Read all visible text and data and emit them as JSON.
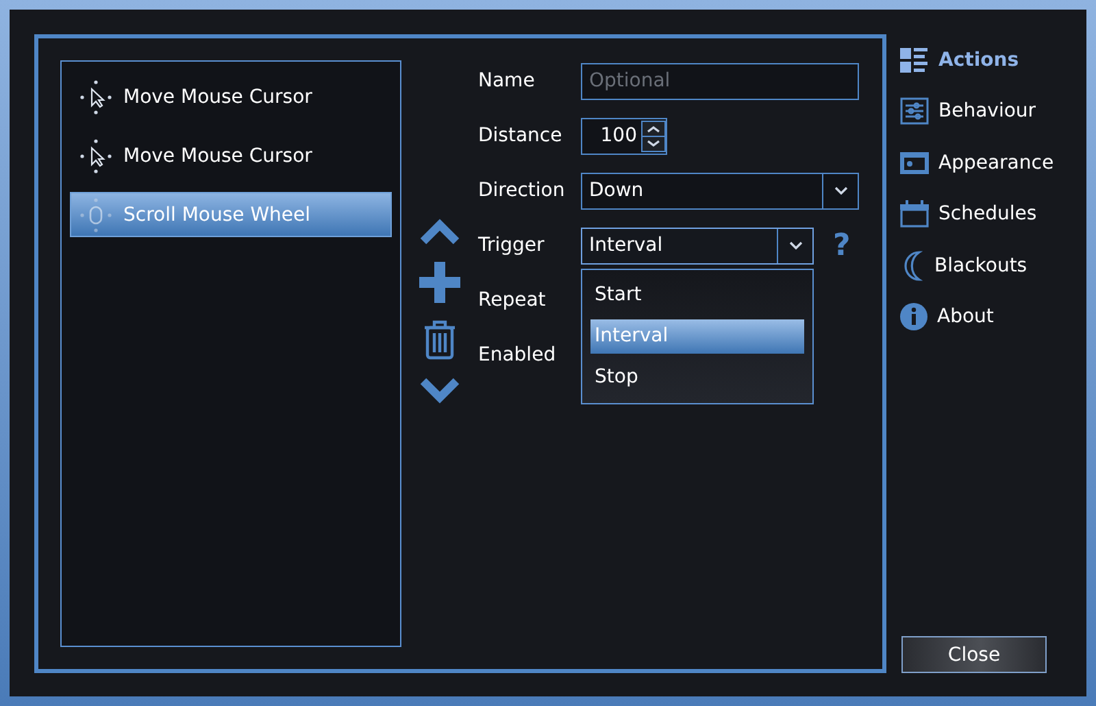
{
  "actions": [
    {
      "label": "Move Mouse Cursor",
      "kind": "move",
      "selected": false
    },
    {
      "label": "Move Mouse Cursor",
      "kind": "move",
      "selected": false
    },
    {
      "label": "Scroll Mouse Wheel",
      "kind": "scroll",
      "selected": true
    }
  ],
  "form": [
    {
      "label": "Name",
      "kind": "text",
      "placeholder": "Optional"
    },
    {
      "label": "Distance",
      "kind": "spinner",
      "value": "100"
    },
    {
      "label": "Direction",
      "kind": "select",
      "value": "Down"
    },
    {
      "label": "Trigger",
      "kind": "select",
      "value": "Interval",
      "expanded": true,
      "help": "?",
      "options": [
        {
          "label": "Start",
          "selected": false
        },
        {
          "label": "Interval",
          "selected": true
        },
        {
          "label": "Stop",
          "selected": false
        }
      ]
    },
    {
      "label": "Repeat",
      "kind": "label"
    },
    {
      "label": "Enabled",
      "kind": "label"
    }
  ],
  "nav": [
    {
      "label": "Actions",
      "kind": "actions",
      "selected": true
    },
    {
      "label": "Behaviour",
      "kind": "behaviour",
      "selected": false
    },
    {
      "label": "Appearance",
      "kind": "appearance",
      "selected": false
    },
    {
      "label": "Schedules",
      "kind": "schedules",
      "selected": false
    },
    {
      "label": "Blackouts",
      "kind": "blackouts",
      "selected": false
    },
    {
      "label": "About",
      "kind": "about",
      "selected": false
    }
  ],
  "close_button": "Close"
}
